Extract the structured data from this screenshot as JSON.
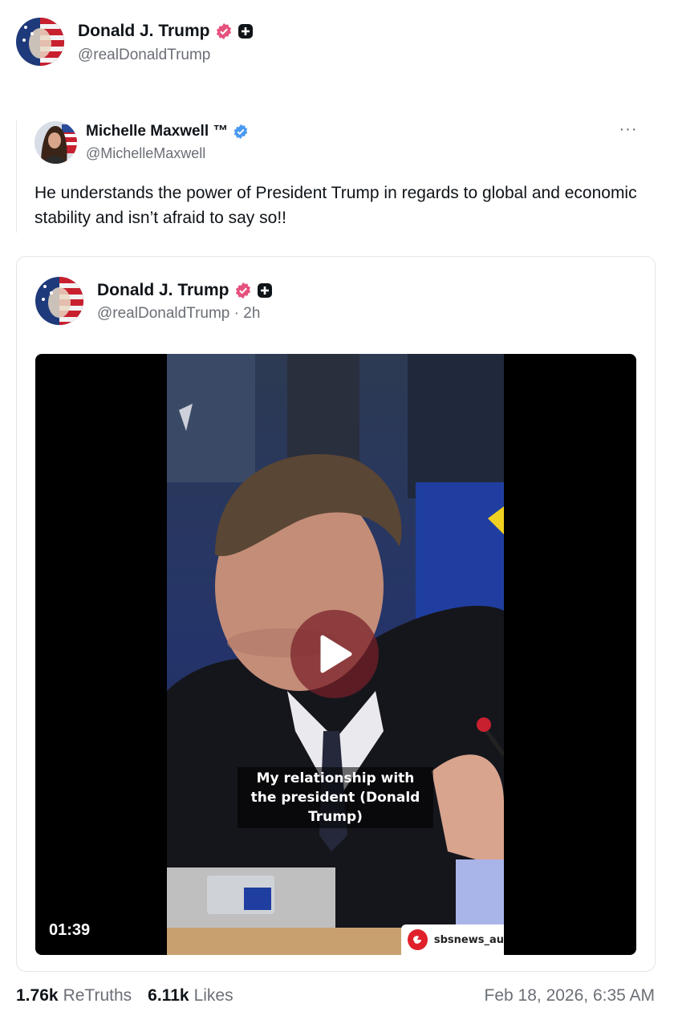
{
  "post": {
    "author_name": "Donald J. Trump",
    "author_handle": "@realDonaldTrump",
    "verified_badge_color": "#e5527d",
    "plus_badge_color": "#0f1419"
  },
  "quoted": {
    "author_name": "Michelle Maxwell ™",
    "author_handle": "@MichelleMaxwell",
    "verified_badge_color": "#4a9af0",
    "more_icon": "ellipsis-icon",
    "more_label": "···",
    "text": "He understands the power of President Trump in regards to global and economic stability and isn’t afraid to say so!!"
  },
  "embedded": {
    "author_name": "Donald J. Trump",
    "author_handle_time": "@realDonaldTrump · 2h",
    "video": {
      "caption": "My relationship with the president (Donald Trump)",
      "duration": "01:39",
      "watermark": "sbsnews_au",
      "play_icon": "play-icon"
    }
  },
  "footer": {
    "retruths_count": "1.76k",
    "retruths_label": "ReTruths",
    "likes_count": "6.11k",
    "likes_label": "Likes",
    "timestamp": "Feb 18, 2026, 6:35 AM"
  }
}
